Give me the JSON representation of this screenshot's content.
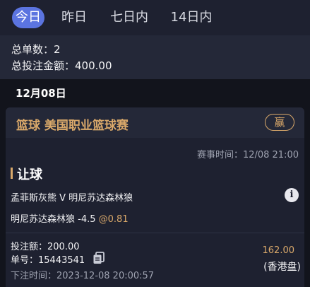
{
  "tabs": [
    {
      "label": "今日"
    },
    {
      "label": "昨日"
    },
    {
      "label": "七日内"
    },
    {
      "label": "14日内"
    }
  ],
  "summary": {
    "total_orders": "总单数：2",
    "total_stake": "总投注金额：400.00"
  },
  "date_heading": "12月08日",
  "card": {
    "title": "篮球 美国职业篮球赛",
    "result": "赢",
    "match_time": "赛事时间：12/08 21:00",
    "market": "让球",
    "teams": "孟菲斯灰熊 V 明尼苏达森林狼",
    "selection": "明尼苏达森林狼 -4.5 ",
    "odds": "@0.81",
    "stake": "投注额：200.00",
    "order_no": "单号：15443541",
    "bet_time": "下注时间：2023-12-08 20:00:57",
    "payout": "162.00",
    "odds_type": "(香港盘)"
  },
  "colors": {
    "accent": "#5b74e0",
    "gold": "#d9a86a",
    "background": "#12141c",
    "panel": "#242838",
    "card": "#1e2130"
  },
  "icons": {
    "info": "info-icon",
    "copy": "copy-icon"
  }
}
